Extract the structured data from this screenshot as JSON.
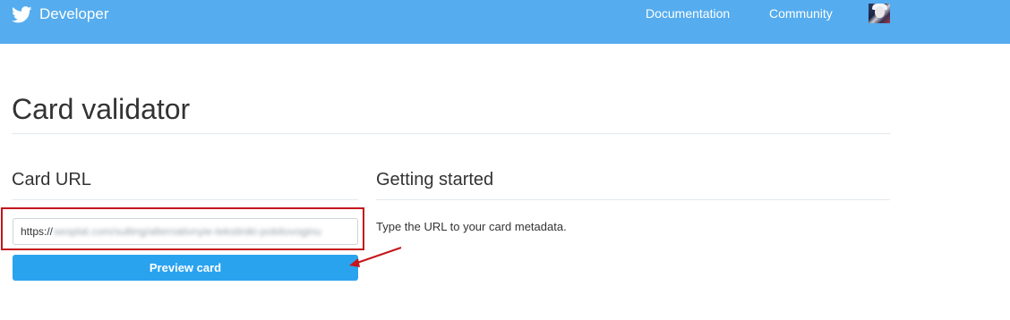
{
  "header": {
    "brand": "Developer",
    "nav": [
      {
        "label": "Documentation"
      },
      {
        "label": "Community"
      }
    ],
    "bg_color": "#55acee"
  },
  "page": {
    "title": "Card validator"
  },
  "card_url": {
    "heading": "Card URL",
    "input_prefix": "https://",
    "input_obscured": "seoplat.com/sulting/alternativnyie-tekstiniki-pobitovoginu",
    "button_label": "Preview card",
    "button_color": "#2aa3ef"
  },
  "getting_started": {
    "heading": "Getting started",
    "text": "Type the URL to your card metadata."
  },
  "annotation": {
    "box_color": "#c4161c",
    "arrow_color": "#c4161c"
  },
  "icons": {
    "brand_icon": "twitter-bird-icon",
    "avatar": "user-avatar"
  }
}
